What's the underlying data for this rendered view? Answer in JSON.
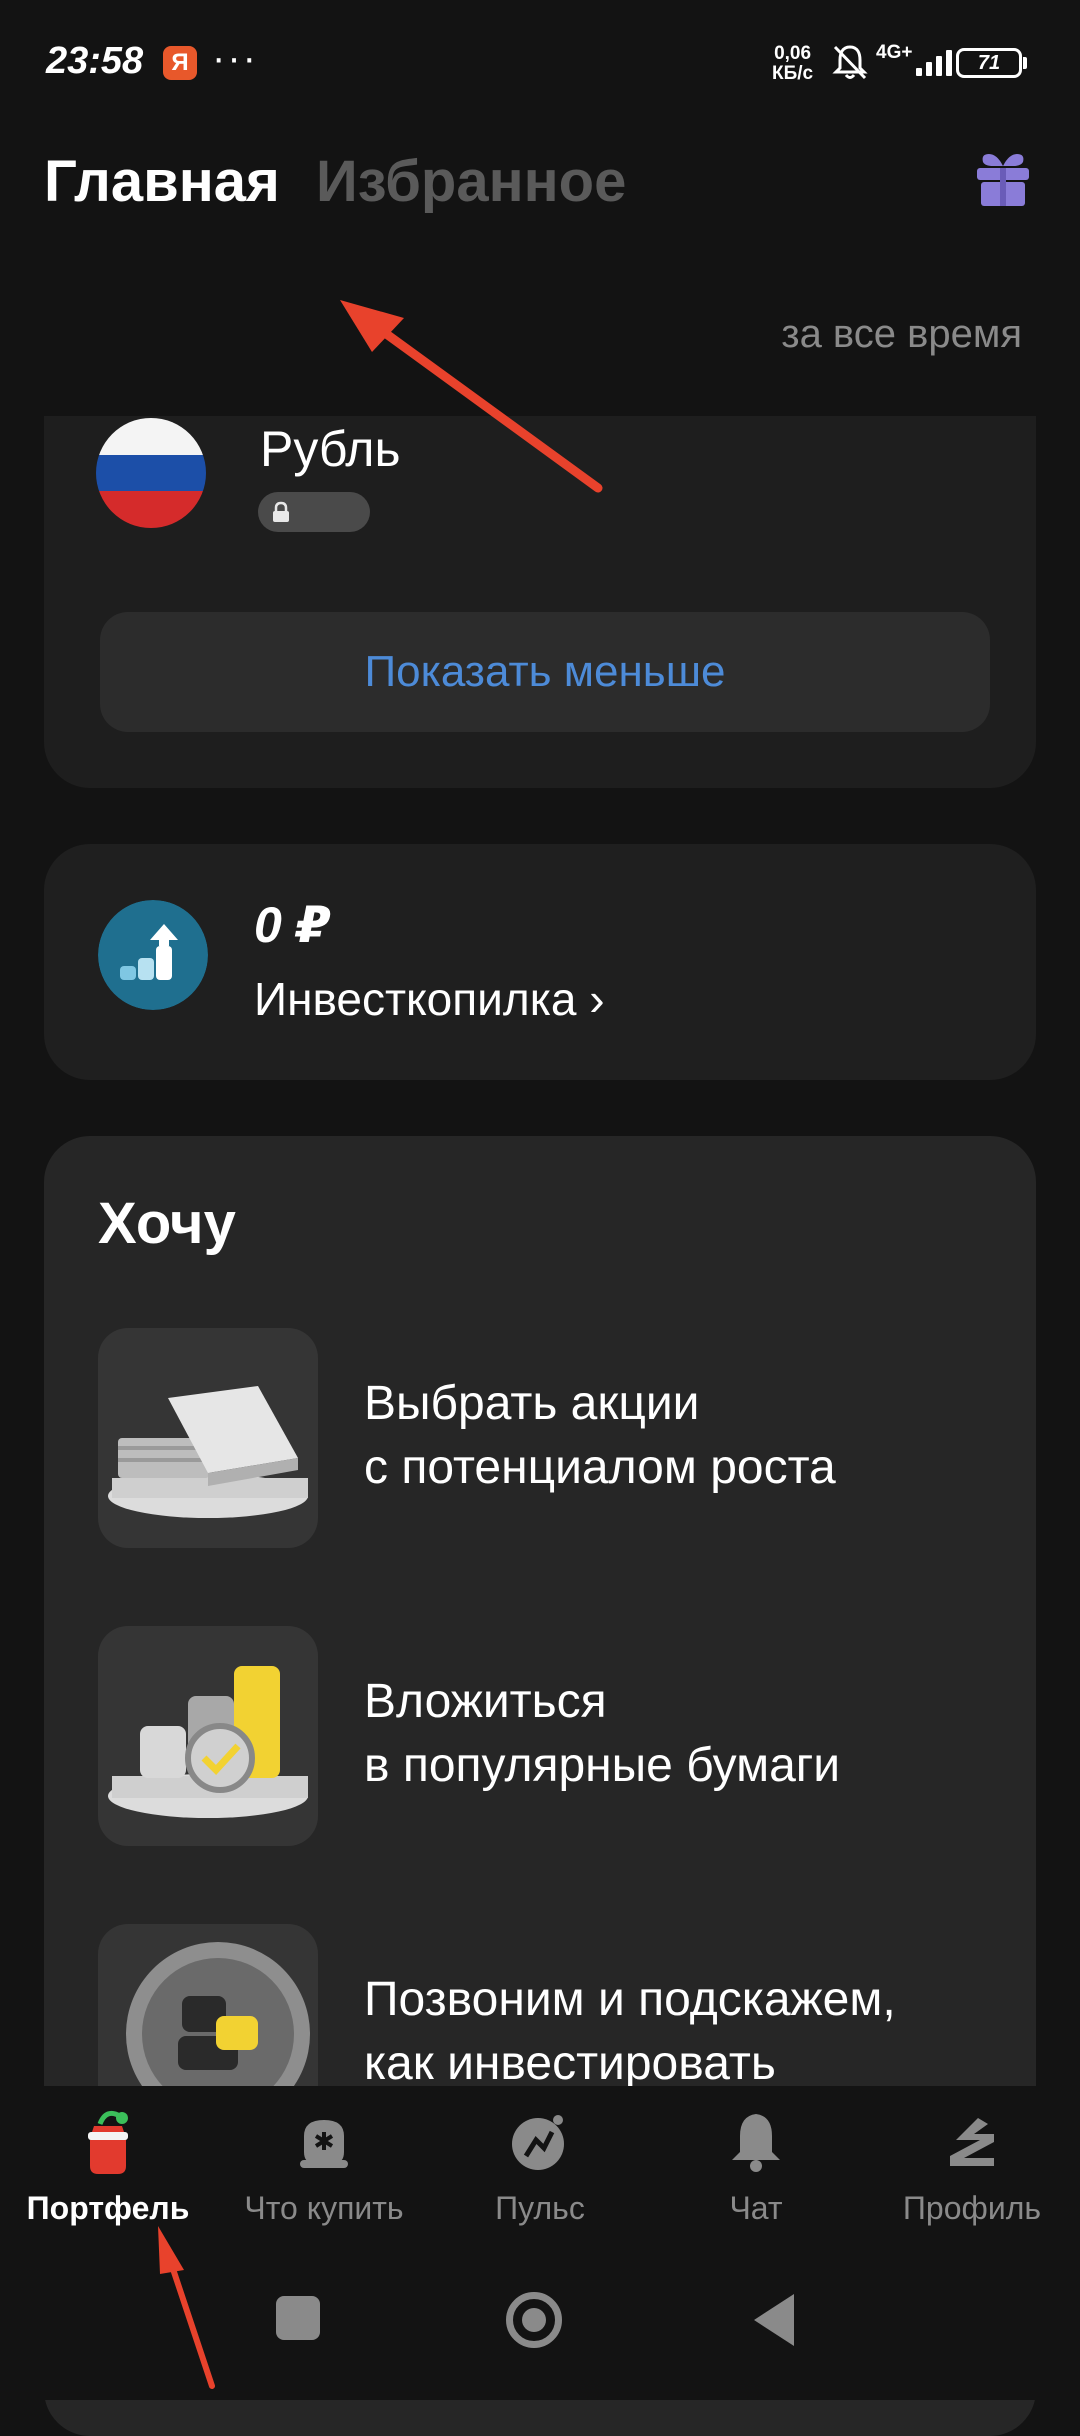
{
  "status_bar": {
    "time": "23:58",
    "app_badge": "Я",
    "more": "···",
    "speed_value": "0,06",
    "speed_unit": "КБ/с",
    "network": "4G+",
    "battery": "71"
  },
  "header": {
    "tab_main": "Главная",
    "tab_favorites": "Избранное"
  },
  "period": "за все время",
  "currency": {
    "name": "Рубль"
  },
  "show_less_label": "Показать меньше",
  "invest": {
    "amount": "0 ₽",
    "link": "Инвесткопилка ›"
  },
  "want": {
    "title": "Хочу",
    "items": [
      {
        "line1": "Выбрать акции",
        "line2": "с потенциалом роста"
      },
      {
        "line1": "Вложиться",
        "line2": "в популярные бумаги"
      },
      {
        "line1": "Позвоним и подскажем,",
        "line2": "как инвестировать"
      }
    ]
  },
  "nav": {
    "items": [
      {
        "label": "Портфель"
      },
      {
        "label": "Что купить"
      },
      {
        "label": "Пульс"
      },
      {
        "label": "Чат"
      },
      {
        "label": "Профиль"
      }
    ]
  },
  "colors": {
    "background": "#131313",
    "card": "#1f1f1f",
    "accent_link": "#4d8bd8",
    "gift": "#8a7cd8",
    "annotation_arrow": "#e8422c"
  }
}
